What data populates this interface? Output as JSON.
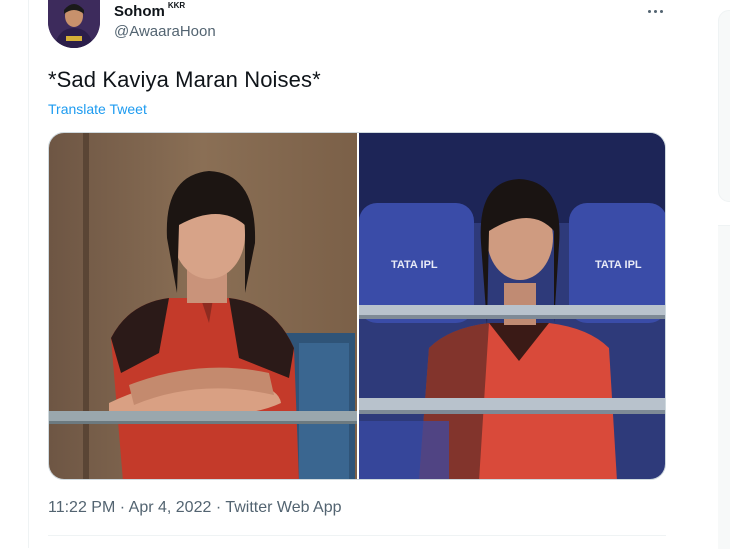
{
  "tweet": {
    "author_name": "Sohom",
    "author_badge": "KKR",
    "author_handle": "@AwaaraHoon",
    "text": "*Sad Kaviya Maran Noises*",
    "translate_label": "Translate Tweet",
    "time": "11:22 PM",
    "separator": "·",
    "date": "Apr 4, 2022",
    "client": "Twitter Web App"
  },
  "icons": {
    "more": "more-options-icon"
  },
  "media": {
    "left_image_text": "",
    "right_image_text": "TATA IPL"
  },
  "colors": {
    "link": "#1d9bf0",
    "secondary_text": "#536471",
    "border": "#cfd9de"
  }
}
